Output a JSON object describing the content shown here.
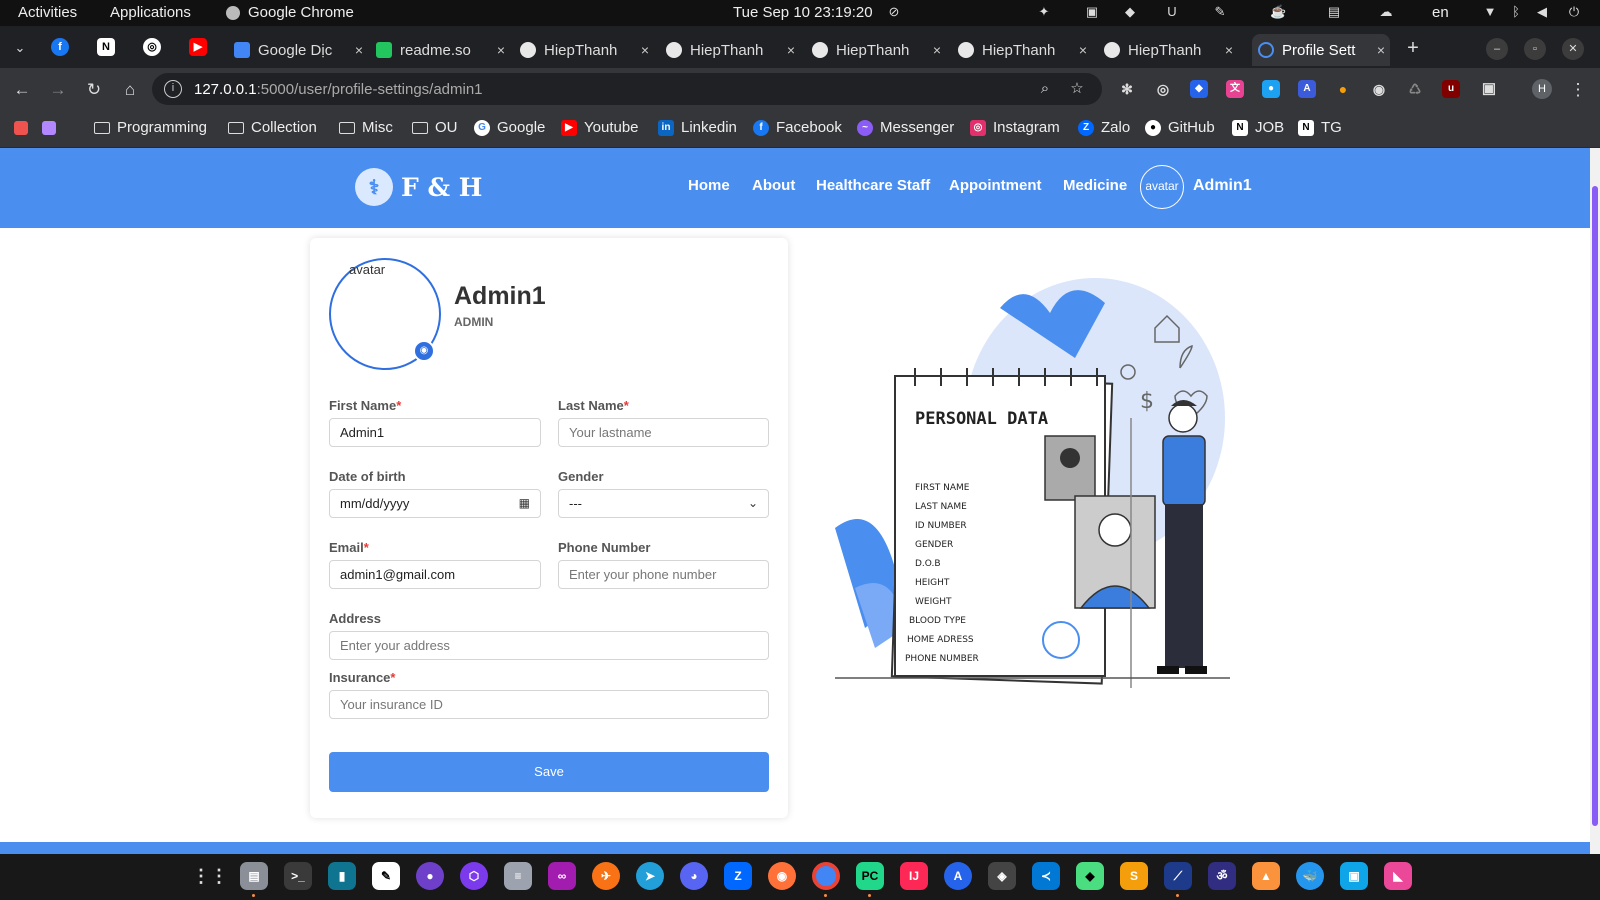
{
  "system": {
    "activities": "Activities",
    "applications": "Applications",
    "app_name": "Google Chrome",
    "clock": "Tue Sep 10  23:19:20",
    "lang": "en"
  },
  "browser": {
    "tabs": [
      {
        "label": "Google Dịc",
        "close": "×"
      },
      {
        "label": "readme.so",
        "close": "×"
      },
      {
        "label": "HiepThanh",
        "close": "×"
      },
      {
        "label": "HiepThanh",
        "close": "×"
      },
      {
        "label": "HiepThanh",
        "close": "×"
      },
      {
        "label": "HiepThanh",
        "close": "×"
      },
      {
        "label": "HiepThanh",
        "close": "×"
      },
      {
        "label": "Profile Sett",
        "close": "×"
      }
    ],
    "new_tab": "+",
    "url_host": "127.0.0.1",
    "url_rest": ":5000/user/profile-settings/admin1",
    "profile_initial": "H",
    "bookmarks": [
      {
        "label": "Programming",
        "icon": "folder-icon"
      },
      {
        "label": "Collection",
        "icon": "folder-icon"
      },
      {
        "label": "Misc",
        "icon": "folder-icon"
      },
      {
        "label": "OU",
        "icon": "folder-icon"
      },
      {
        "label": "Google",
        "icon": "google-icon"
      },
      {
        "label": "Youtube",
        "icon": "youtube-icon"
      },
      {
        "label": "Linkedin",
        "icon": "linkedin-icon"
      },
      {
        "label": "Facebook",
        "icon": "facebook-icon"
      },
      {
        "label": "Messenger",
        "icon": "messenger-icon"
      },
      {
        "label": "Instagram",
        "icon": "instagram-icon"
      },
      {
        "label": "Zalo",
        "icon": "zalo-icon"
      },
      {
        "label": "GitHub",
        "icon": "github-icon"
      },
      {
        "label": "JOB",
        "icon": "notion-icon"
      },
      {
        "label": "TG",
        "icon": "notion-icon"
      }
    ]
  },
  "site": {
    "brand": "F & H",
    "nav": [
      "Home",
      "About",
      "Healthcare Staff",
      "Appointment",
      "Medicine"
    ],
    "avatar_alt": "avatar",
    "user": "Admin1",
    "accent": "#4a8ef0"
  },
  "profile": {
    "avatar_alt": "avatar",
    "name": "Admin1",
    "role": "ADMIN",
    "fields": {
      "first_name": {
        "label": "First Name",
        "required": "*",
        "value": "Admin1"
      },
      "last_name": {
        "label": "Last Name",
        "required": "*",
        "placeholder": "Your lastname"
      },
      "dob": {
        "label": "Date of birth",
        "placeholder": "mm/dd/yyyy"
      },
      "gender": {
        "label": "Gender",
        "value": "---"
      },
      "email": {
        "label": "Email",
        "required": "*",
        "value": "admin1@gmail.com"
      },
      "phone": {
        "label": "Phone Number",
        "placeholder": "Enter your phone number"
      },
      "address": {
        "label": "Address",
        "placeholder": "Enter your address"
      },
      "insurance": {
        "label": "Insurance",
        "required": "*",
        "placeholder": "Your insurance ID"
      }
    },
    "save_label": "Save"
  },
  "illustration": {
    "title": "PERSONAL DATA",
    "rows": [
      "FIRST NAME",
      "LAST NAME",
      "ID NUMBER",
      "GENDER",
      "D.O.B",
      "HEIGHT",
      "WEIGHT",
      "BLOOD TYPE",
      "HOME ADRESS",
      "PHONE NUMBER"
    ]
  }
}
